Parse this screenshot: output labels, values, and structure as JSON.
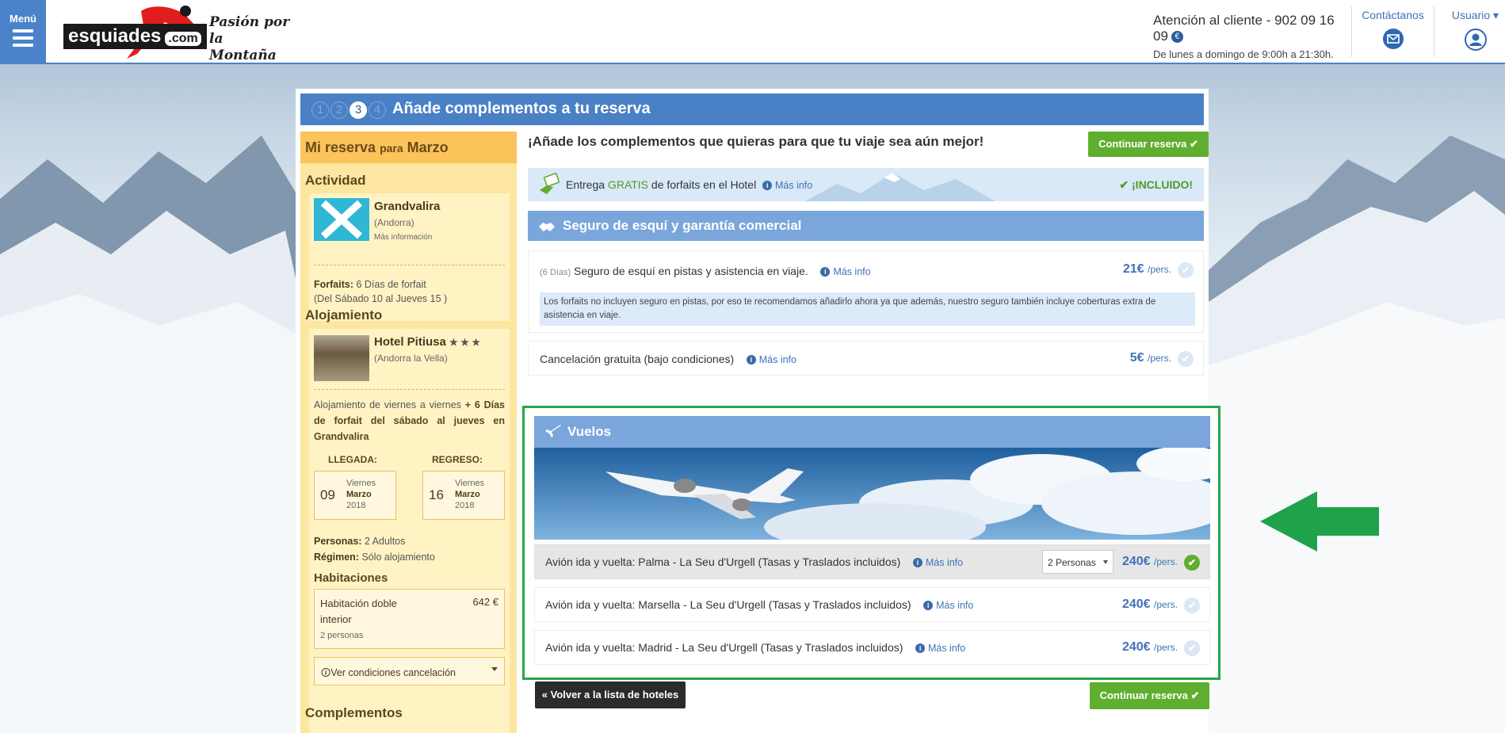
{
  "header": {
    "menu_label": "Menú",
    "brand": "esquiades",
    "brand_suffix": ".com",
    "slogan_line1": "Pasión por",
    "slogan_line2": "la Montaña",
    "phone_line": "Atención al cliente - 902 09 16 09",
    "hours_line": "De lunes a domingo de 9:00h a 21:30h.",
    "euro_symbol": "€",
    "contact_label": "Contáctanos",
    "user_label": "Usuario"
  },
  "steps": {
    "items": [
      "1",
      "2",
      "3",
      "4"
    ],
    "active": "3",
    "title": "Añade complementos a tu reserva"
  },
  "sidebar": {
    "title": "Mi reserva",
    "title_para": "para",
    "title_month": "Marzo",
    "actividad_heading": "Actividad",
    "act_name": "Grandvalira",
    "act_location": "(Andorra)",
    "act_more": "Más información",
    "forfaits_label": "Forfaits:",
    "forfaits_value": "6 Días de forfait",
    "forfaits_dates": "(Del Sábado 10 al Jueves 15 )",
    "alojamiento_heading": "Alojamiento",
    "hotel_name": "Hotel Pitiusa",
    "hotel_stars": "★ ★ ★",
    "hotel_location": "(Andorra la Vella)",
    "hotel_desc_1": "Alojamiento de viernes a viernes",
    "hotel_desc_2": "+ 6 Días de forfait del sábado al jueves en Grandvalira",
    "llegada_label": "LLEGADA:",
    "regreso_label": "REGRESO:",
    "llegada": {
      "day": "09",
      "weekday": "Viernes",
      "month": "Marzo",
      "year": "2018"
    },
    "regreso": {
      "day": "16",
      "weekday": "Viernes",
      "month": "Marzo",
      "year": "2018"
    },
    "personas_label": "Personas:",
    "personas_value": "2 Adultos",
    "regimen_label": "Régimen:",
    "regimen_value": "Sólo alojamiento",
    "habitaciones_heading": "Habitaciones",
    "hab_name": "Habitación doble interior",
    "hab_price": "642 €",
    "hab_people": "2 personas",
    "cond_label": "Ver condiciones cancelación",
    "complementos_heading": "Complementos"
  },
  "content": {
    "intro": "¡Añade los complementos que quieras para que tu viaje sea aún mejor!",
    "continue_label": "Continuar reserva",
    "check": "✔",
    "free": {
      "pre": "Entrega",
      "gratis": "GRATIS",
      "post": "de forfaits en el Hotel",
      "more": "Más info",
      "included": "✔ ¡INCLUIDO!"
    },
    "seguro_heading": "Seguro de esquí y garantía comercial",
    "insurance": {
      "days": "(6 Días)",
      "label": "Seguro de esquí en pistas y asistencia en viaje.",
      "more": "Más info",
      "price": "21€",
      "unit": "/pers.",
      "note": "Los forfaits no incluyen seguro en pistas, por eso te recomendamos añadirlo ahora ya que además, nuestro seguro también incluye coberturas extra de asistencia en viaje."
    },
    "cancel": {
      "label": "Cancelación gratuita (bajo condiciones)",
      "more": "Más info",
      "price": "5€",
      "unit": "/pers."
    },
    "vuelos_heading": "Vuelos",
    "flights": [
      {
        "label": "Avión ida y vuelta: Palma - La Seu d'Urgell (Tasas y Traslados incluidos)",
        "more": "Más info",
        "price": "240€",
        "unit": "/pers.",
        "select": "2 Personas",
        "selected": true
      },
      {
        "label": "Avión ida y vuelta: Marsella - La Seu d'Urgell (Tasas y Traslados incluidos)",
        "more": "Más info",
        "price": "240€",
        "unit": "/pers.",
        "selected": false
      },
      {
        "label": "Avión ida y vuelta: Madrid - La Seu d'Urgell (Tasas y Traslados incluidos)",
        "more": "Más info",
        "price": "240€",
        "unit": "/pers.",
        "selected": false
      }
    ],
    "back_label": "« Volver a la lista de hoteles",
    "colors": {
      "accent_green": "#5fae2e",
      "brand_blue": "#4a80c6",
      "highlight": "#27a64a"
    }
  }
}
